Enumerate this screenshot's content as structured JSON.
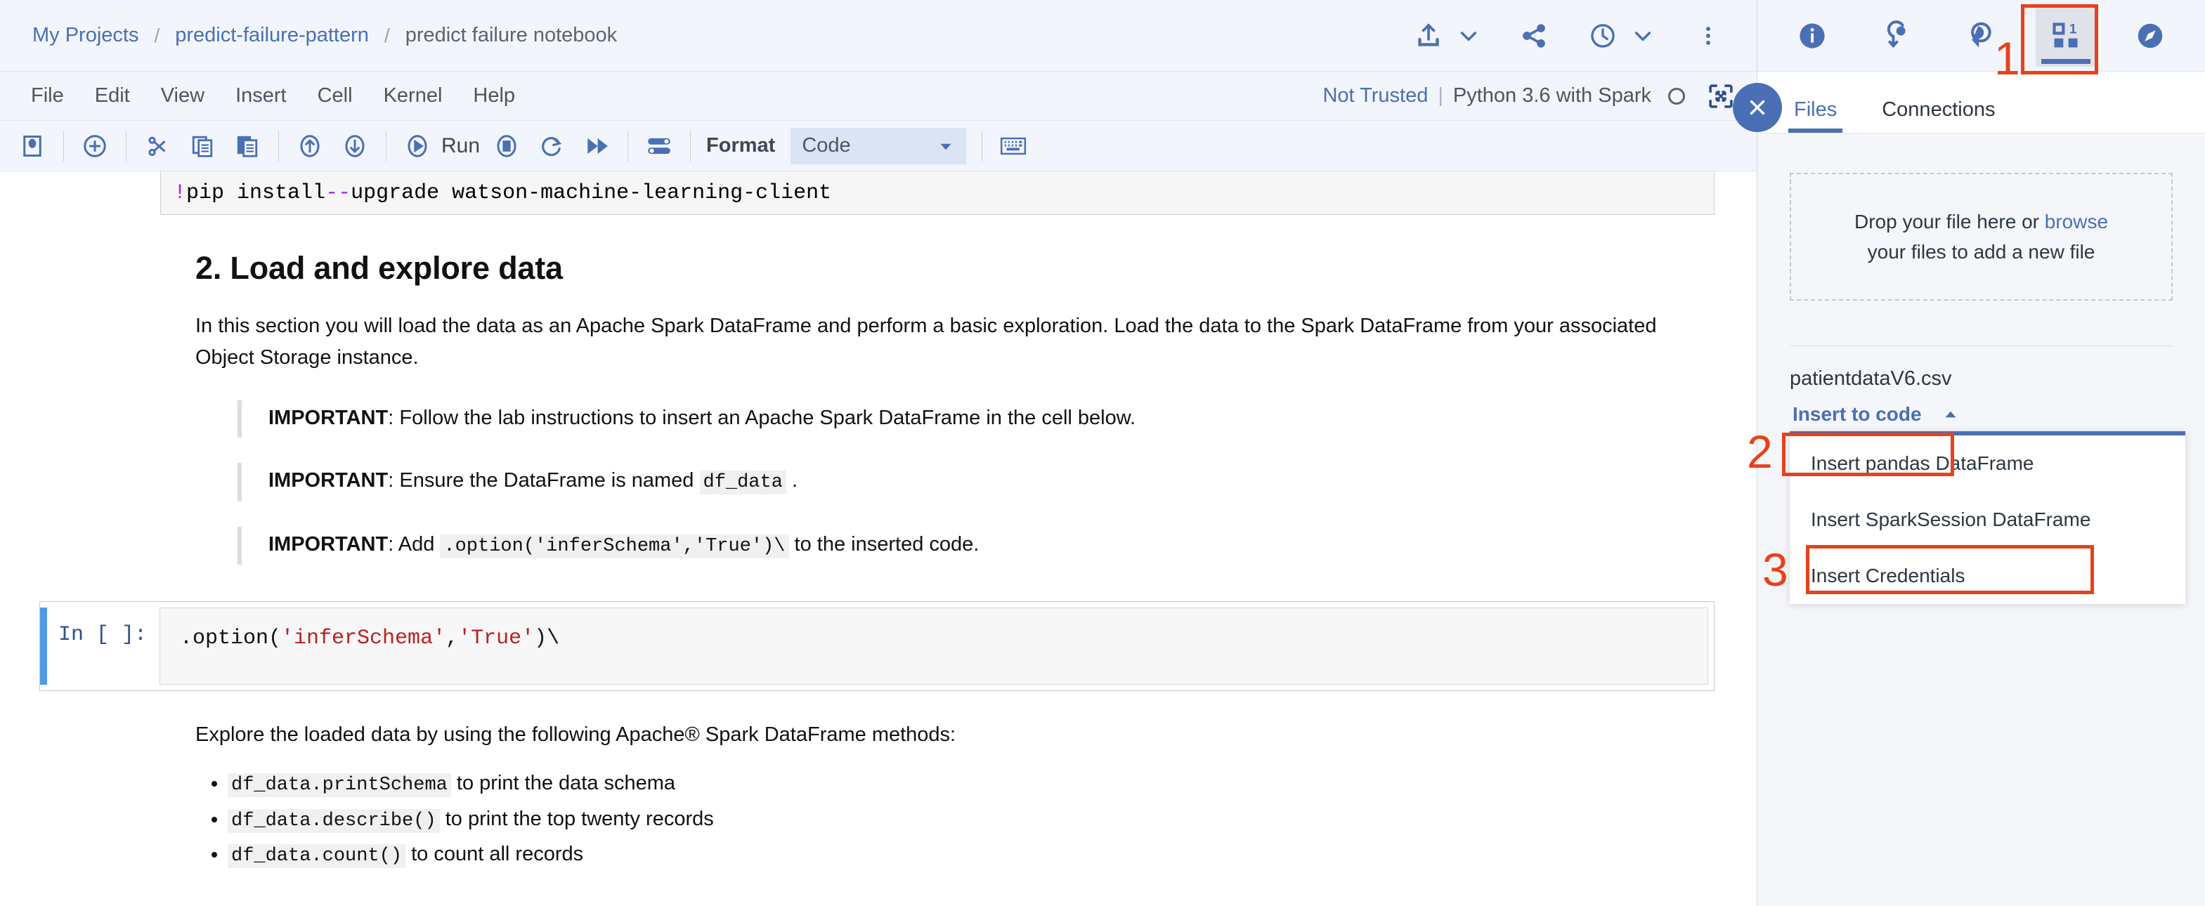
{
  "breadcrumb": {
    "items": [
      {
        "label": "My Projects",
        "current": false
      },
      {
        "label": "predict-failure-pattern",
        "current": false
      },
      {
        "label": "predict failure notebook",
        "current": true
      }
    ],
    "separator": "/"
  },
  "header_actions": {
    "upload_icon": "upload-icon",
    "upload_caret": "chevron-down-icon",
    "share_icon": "share-icon",
    "history_icon": "clock-icon",
    "history_caret": "chevron-down-icon",
    "overflow_icon": "overflow-menu-icon"
  },
  "menu": {
    "items": [
      "File",
      "Edit",
      "View",
      "Insert",
      "Cell",
      "Kernel",
      "Help"
    ],
    "trust_status": "Not Trusted",
    "separator": "|",
    "kernel_name": "Python 3.6 with Spark",
    "kernel_indicator": "kernel-idle-circle",
    "fullscreen_icon": "fullscreen-icon"
  },
  "toolbar": {
    "save_icon": "save-icon",
    "add_icon": "add-cell-icon",
    "cut_icon": "scissors-icon",
    "copy_icon": "copy-icon",
    "paste_icon": "paste-icon",
    "move_up_icon": "arrow-up-icon",
    "move_down_icon": "arrow-down-icon",
    "run_icon": "run-icon",
    "run_label": "Run",
    "stop_icon": "stop-icon",
    "restart_icon": "restart-icon",
    "fast_forward_icon": "fast-forward-icon",
    "toggle_icon": "toggle-sliders-icon",
    "format_label": "Format",
    "format_value": "Code",
    "format_caret": "caret-down-icon",
    "keyboard_icon": "keyboard-icon"
  },
  "notebook": {
    "top_cell_code": "!pip install --upgrade watson-machine-learning-client",
    "top_cell_bang": "!",
    "top_cell_flag": "--",
    "section_title": "2. Load and explore data",
    "intro_paragraph": "In this section you will load the data as an Apache Spark DataFrame and perform a basic exploration. Load the data to the Spark DataFrame from your associated Object Storage instance.",
    "callouts": [
      {
        "bold": "IMPORTANT",
        "text_before": ": Follow the lab instructions to insert an Apache Spark DataFrame in the cell below.",
        "code": "",
        "text_after": ""
      },
      {
        "bold": "IMPORTANT",
        "text_before": ": Ensure the DataFrame is named ",
        "code": "df_data",
        "text_after": " ."
      },
      {
        "bold": "IMPORTANT",
        "text_before": ": Add ",
        "code": ".option('inferSchema','True')\\",
        "text_after": " to the inserted code."
      }
    ],
    "selected_cell": {
      "prompt": "In [ ]:",
      "code_prefix": ".option(",
      "code_str1": "'inferSchema'",
      "code_comma": ",",
      "code_str2": "'True'",
      "code_suffix": ")\\"
    },
    "explore_paragraph": "Explore the loaded data by using the following Apache® Spark DataFrame methods:",
    "methods": [
      {
        "code": "df_data.printSchema",
        "text": " to print the data schema"
      },
      {
        "code": "df_data.describe()",
        "text": " to print the top twenty records"
      },
      {
        "code": "df_data.count()",
        "text": " to count all records"
      }
    ]
  },
  "right_panel": {
    "icons": [
      {
        "name": "info-icon",
        "active": false
      },
      {
        "name": "bookmark-pin-icon",
        "active": false
      },
      {
        "name": "comment-icon",
        "active": false
      },
      {
        "name": "data-asset-grid-icon",
        "active": true
      },
      {
        "name": "compass-icon",
        "active": false
      }
    ],
    "close_icon": "close-icon",
    "tabs": [
      {
        "label": "Files",
        "active": true
      },
      {
        "label": "Connections",
        "active": false
      }
    ],
    "dropzone": {
      "line1_pre": "Drop your file here or ",
      "line1_link": "browse",
      "line2": "your files to add a new file"
    },
    "file_name": "patientdataV6.csv",
    "insert_to_code": {
      "label": "Insert to code",
      "caret": "caret-up-icon",
      "options": [
        "Insert pandas DataFrame",
        "Insert SparkSession DataFrame",
        "Insert Credentials"
      ]
    }
  },
  "annotations": {
    "color": "#e8411c",
    "markers": [
      {
        "number": "1",
        "target": "data-asset-grid-icon"
      },
      {
        "number": "2",
        "target": "insert-to-code-button"
      },
      {
        "number": "3",
        "target": "insert-sparksession-dataframe-option"
      }
    ]
  },
  "colors": {
    "accent_blue": "#4a6fb4",
    "annotation_red": "#e8411c",
    "chrome_bg": "#f2f5fb",
    "panel_bg": "#f4f6fa",
    "cell_selected_bar": "#4f9ae8"
  }
}
